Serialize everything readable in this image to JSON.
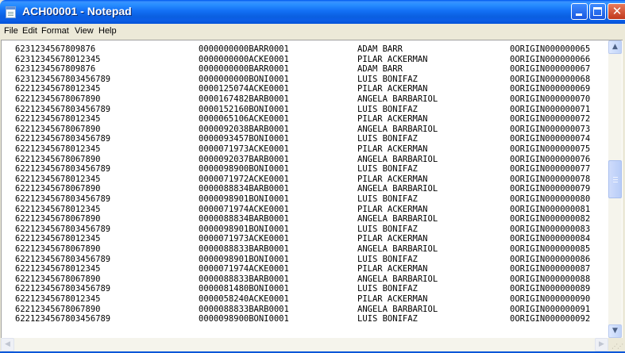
{
  "window": {
    "title": "ACH00001 - Notepad",
    "buttons": {
      "minimize_icon": "minimize-icon",
      "maximize_icon": "maximize-icon",
      "close_icon": "close-icon",
      "close_glyph": "✕"
    }
  },
  "menu": [
    {
      "label": "File"
    },
    {
      "label": "Edit"
    },
    {
      "label": "Format"
    },
    {
      "label": "View"
    },
    {
      "label": "Help"
    }
  ],
  "rows": [
    [
      "6231234567809876",
      "0000000000BARR0001",
      "ADAM  BARR",
      "0ORIGIN000000065"
    ],
    [
      "62312345678012345",
      "0000000000ACKE0001",
      "PILAR  ACKERMAN",
      "0ORIGIN000000066"
    ],
    [
      "6231234567809876",
      "0000000000BARR0001",
      "ADAM  BARR",
      "0ORIGIN000000067"
    ],
    [
      "623123456780345678​9",
      "0000000000BONI0001",
      "LUIS  BONIFAZ",
      "0ORIGIN000000068"
    ],
    [
      "62212345678012345",
      "0000125074ACKE0001",
      "PILAR  ACKERMAN",
      "0ORIGIN000000069"
    ],
    [
      "6221234567806789​0",
      "0000167482BARB0001",
      "ANGELA  BARBARIOL",
      "0ORIGIN000000070"
    ],
    [
      "622123456780345678​9",
      "0000152160BONI0001",
      "LUIS  BONIFAZ",
      "0ORIGIN000000071"
    ],
    [
      "62212345678012345",
      "0000065106ACKE0001",
      "PILAR  ACKERMAN",
      "0ORIGIN000000072"
    ],
    [
      "6221234567806789​0",
      "0000092038BARB0001",
      "ANGELA  BARBARIOL",
      "0ORIGIN000000073"
    ],
    [
      "622123456780345678​9",
      "0000093457BONI0001",
      "LUIS  BONIFAZ",
      "0ORIGIN000000074"
    ],
    [
      "62212345678012345",
      "0000071973ACKE0001",
      "PILAR  ACKERMAN",
      "0ORIGIN000000075"
    ],
    [
      "6221234567806789​0",
      "0000092037BARB0001",
      "ANGELA  BARBARIOL",
      "0ORIGIN000000076"
    ],
    [
      "622123456780345678​9",
      "0000098900BONI0001",
      "LUIS  BONIFAZ",
      "0ORIGIN000000077"
    ],
    [
      "62212345678012345",
      "0000071972ACKE0001",
      "PILAR  ACKERMAN",
      "0ORIGIN000000078"
    ],
    [
      "6221234567806789​0",
      "0000088834BARB0001",
      "ANGELA  BARBARIOL",
      "0ORIGIN000000079"
    ],
    [
      "622123456780345678​9",
      "0000098901BONI0001",
      "LUIS  BONIFAZ",
      "0ORIGIN000000080"
    ],
    [
      "62212345678012345",
      "0000071974ACKE0001",
      "PILAR  ACKERMAN",
      "0ORIGIN000000081"
    ],
    [
      "6221234567806789​0",
      "0000088834BARB0001",
      "ANGELA  BARBARIOL",
      "0ORIGIN000000082"
    ],
    [
      "622123456780345678​9",
      "0000098901BONI0001",
      "LUIS  BONIFAZ",
      "0ORIGIN000000083"
    ],
    [
      "62212345678012345",
      "0000071973ACKE0001",
      "PILAR  ACKERMAN",
      "0ORIGIN000000084"
    ],
    [
      "6221234567806789​0",
      "0000088833BARB0001",
      "ANGELA  BARBARIOL",
      "0ORIGIN000000085"
    ],
    [
      "622123456780345678​9",
      "0000098901BONI0001",
      "LUIS  BONIFAZ",
      "0ORIGIN000000086"
    ],
    [
      "62212345678012345",
      "0000071974ACKE0001",
      "PILAR  ACKERMAN",
      "0ORIGIN000000087"
    ],
    [
      "6221234567806789​0",
      "0000088833BARB0001",
      "ANGELA  BARBARIOL",
      "0ORIGIN000000088"
    ],
    [
      "622123456780345678​9",
      "0000081480BONI0001",
      "LUIS  BONIFAZ",
      "0ORIGIN000000089"
    ],
    [
      "62212345678012345",
      "0000058240ACKE0001",
      "PILAR  ACKERMAN",
      "0ORIGIN000000090"
    ],
    [
      "6221234567806789​0",
      "0000088833BARB0001",
      "ANGELA  BARBARIOL",
      "0ORIGIN000000091"
    ],
    [
      "622123456780345678​9",
      "0000098900BONI0001",
      "LUIS  BONIFAZ",
      "0ORIGIN000000092"
    ]
  ],
  "scrollbars": {
    "up_arrow": "▲",
    "down_arrow": "▼",
    "left_arrow": "◀",
    "right_arrow": "▶"
  }
}
